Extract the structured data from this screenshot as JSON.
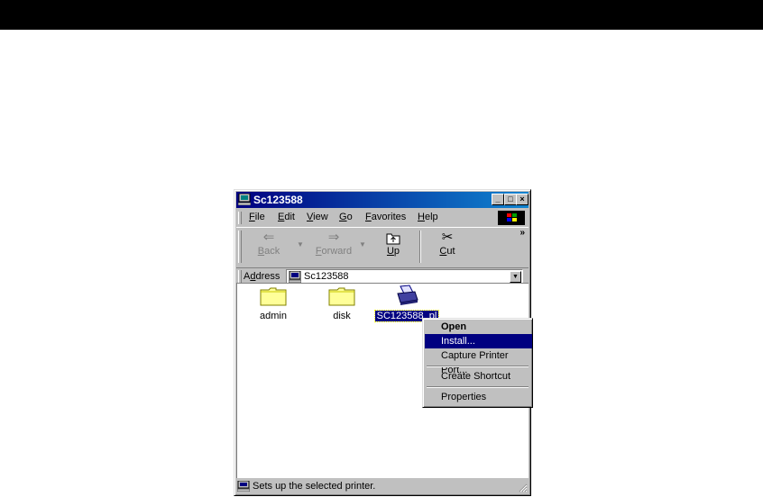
{
  "window": {
    "title": "Sc123588"
  },
  "menubar": {
    "items": [
      "File",
      "Edit",
      "View",
      "Go",
      "Favorites",
      "Help"
    ]
  },
  "toolbar": {
    "back": "Back",
    "forward": "Forward",
    "up": "Up",
    "cut": "Cut"
  },
  "address": {
    "label_prefix": "A",
    "label_underlined": "d",
    "label_rest": "dress",
    "value": "Sc123588"
  },
  "files": [
    {
      "name": "admin",
      "type": "folder"
    },
    {
      "name": "disk",
      "type": "folder"
    },
    {
      "name": "SC123588_pl",
      "type": "printer"
    }
  ],
  "context_menu": {
    "open": "Open",
    "install": "Install...",
    "capture": "Capture Printer Port...",
    "shortcut": "Create Shortcut",
    "properties": "Properties"
  },
  "status": {
    "text": "Sets up the selected printer."
  },
  "colors": {
    "title_bar": "#000080",
    "selection": "#000080",
    "chrome": "#c0c0c0"
  }
}
